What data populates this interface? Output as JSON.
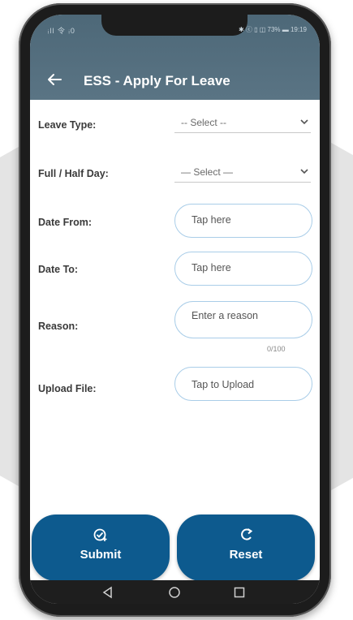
{
  "status_bar": {
    "left": "ᵢll 令 ᵢ0",
    "right": "✱ ⓒ ▯ ◫ 73% ▬ 19:19"
  },
  "app_bar": {
    "title": "ESS - Apply For Leave"
  },
  "form": {
    "leave_type": {
      "label": "Leave Type:",
      "value": "-- Select --"
    },
    "day_type": {
      "label": "Full / Half Day:",
      "value": "— Select —"
    },
    "date_from": {
      "label": "Date From:",
      "placeholder": "Tap here"
    },
    "date_to": {
      "label": "Date To:",
      "placeholder": "Tap here"
    },
    "reason": {
      "label": "Reason:",
      "placeholder": "Enter a reason",
      "counter": "0/100"
    },
    "upload": {
      "label": "Upload File:",
      "placeholder": "Tap to Upload"
    }
  },
  "actions": {
    "submit_label": "Submit",
    "reset_label": "Reset"
  },
  "colors": {
    "app_bar": "#4d6878",
    "button": "#0d5a8e",
    "field_border": "#a9cde8"
  }
}
